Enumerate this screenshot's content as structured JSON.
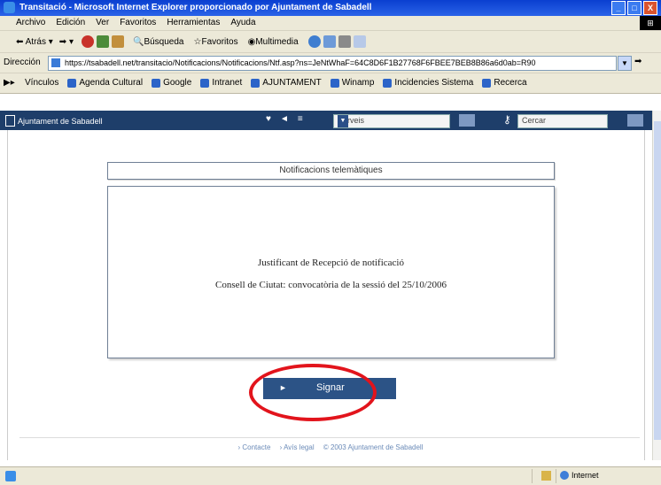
{
  "window": {
    "title": "Transitació - Microsoft Internet Explorer proporcionado por Ajuntament de Sabadell",
    "buttons": [
      "_",
      "□",
      "X"
    ]
  },
  "menubar": {
    "items": [
      "Archivo",
      "Edición",
      "Ver",
      "Favoritos",
      "Herramientas",
      "Ayuda"
    ]
  },
  "toolbar": {
    "back_label": "Atrás",
    "search_label": "Búsqueda",
    "favorites_label": "Favoritos",
    "multimedia_label": "Multimedia"
  },
  "address": {
    "label": "Dirección",
    "url": "https://tsabadell.net/transitacio/Notificacions/Notificacions/Ntf.asp?ns=JeNtWhaF=64C8D6F1B27768F6FBEE7BEB8B86a6d0ab=R90"
  },
  "links": {
    "label": "Vínculos",
    "items": [
      "Agenda Cultural",
      "Google",
      "Intranet",
      "AJUNTAMENT",
      "Winamp",
      "Incidencies Sistema",
      "Recerca"
    ]
  },
  "site_header": {
    "brand": "Ajuntament de Sabadell",
    "nav": [
      "♥",
      "◄",
      "≡"
    ],
    "services_placeholder": "Serveis",
    "search_placeholder": "Cercar"
  },
  "page": {
    "heading": "Notificacions telemàtiques",
    "receipt_title": "Justificant de Recepció de notificació",
    "receipt_detail": "Consell de Ciutat: convocatòria de la sessió del 25/10/2006",
    "sign_button": "Signar",
    "sign_icon": "►"
  },
  "footer": {
    "contact": "› Contacte",
    "legal": "› Avís legal",
    "copyright": "© 2003 Ajuntament de Sabadell"
  },
  "statusbar": {
    "zone": "Internet"
  },
  "colors": {
    "site_header_bg": "#1e3e6a",
    "button_bg": "#2c5386",
    "annotation_ring": "#e2141c",
    "footer_link": "#6b8bb8"
  }
}
